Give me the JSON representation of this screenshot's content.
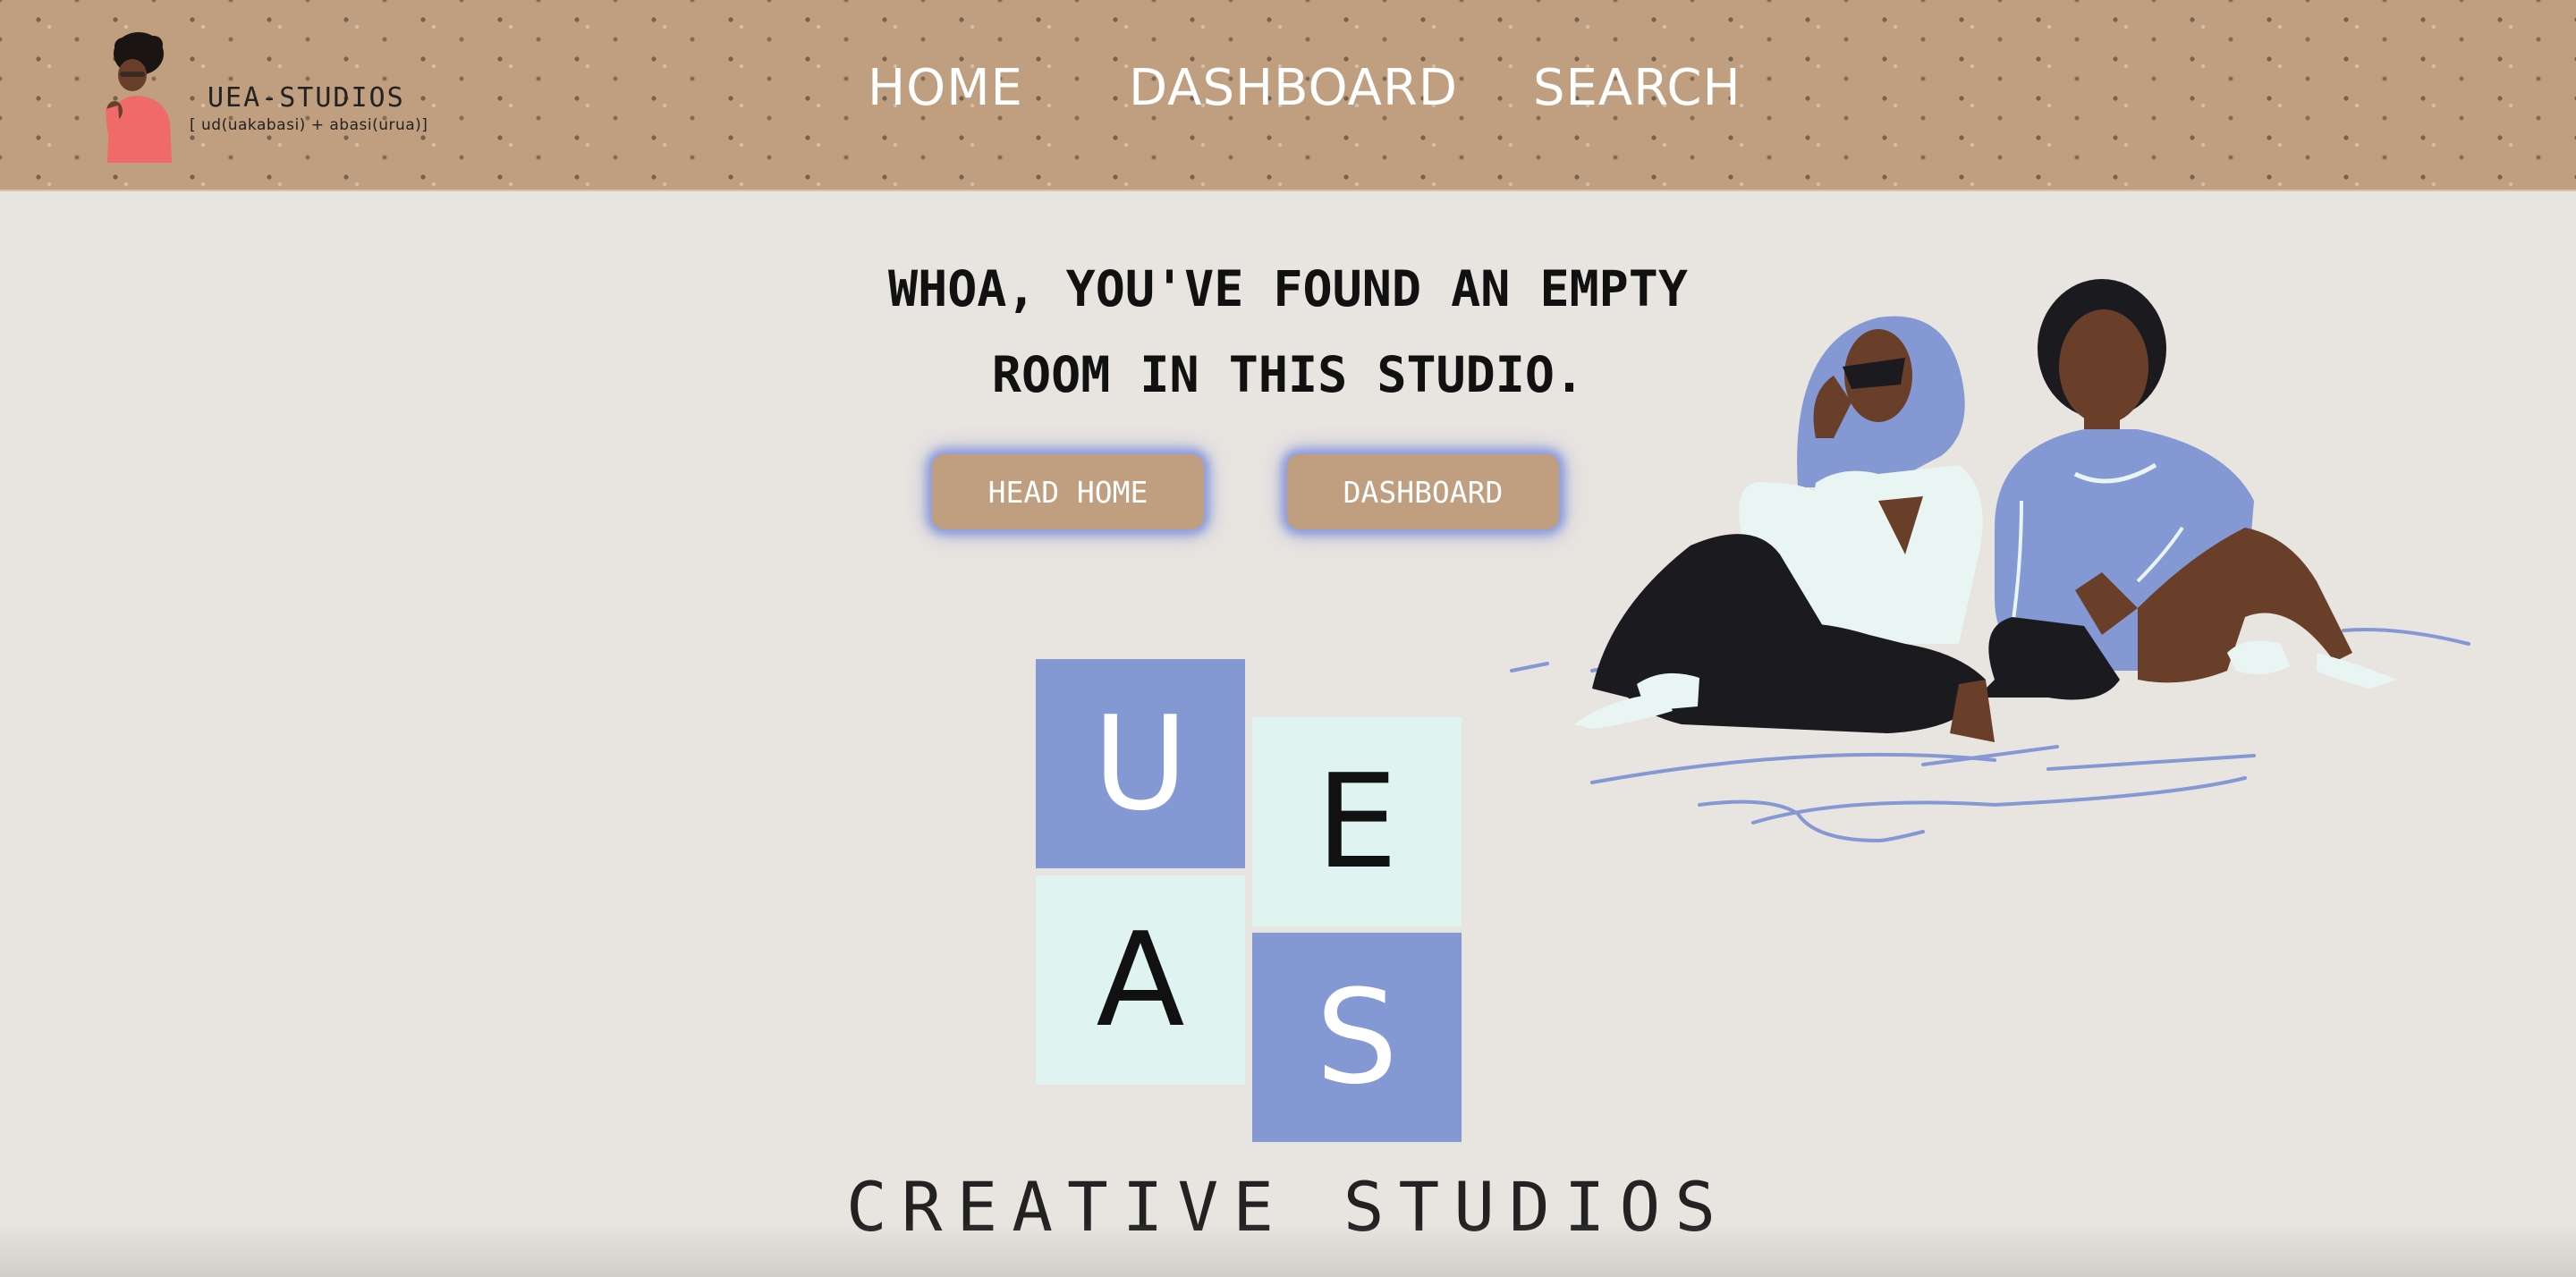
{
  "header": {
    "brand_name": "UEA-STUDIOS",
    "brand_sub": "[ ud(uakabasi) + abasi(urua)]",
    "nav": [
      "HOME",
      "DASHBOARD",
      "SEARCH"
    ]
  },
  "hero": {
    "headline_line1": "WHOA, YOU'VE FOUND AN EMPTY",
    "headline_line2": "ROOM IN THIS STUDIO.",
    "buttons": [
      "HEAD HOME",
      "DASHBOARD"
    ]
  },
  "logo_tiles": [
    "U",
    "E",
    "A",
    "S"
  ],
  "tagline": "CREATIVE STUDIOS",
  "colors": {
    "header_bg": "#bf9f80",
    "page_bg": "#e8e4e0",
    "tile_blue": "#8499d4",
    "tile_mint": "#dff3f1",
    "button_glow": "#8a9bde"
  },
  "icons": {
    "logo": "woman-avatar-icon",
    "illustration": "two-women-sitting-illustration"
  }
}
